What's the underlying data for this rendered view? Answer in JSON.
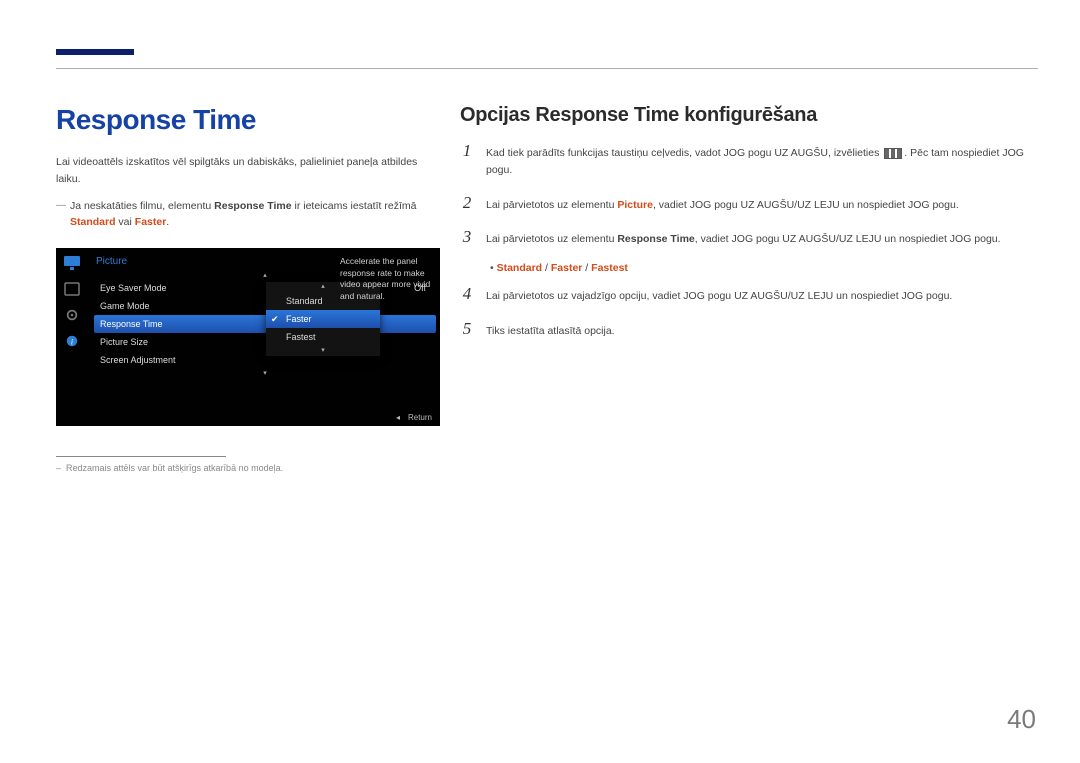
{
  "page_number": "40",
  "left": {
    "heading": "Response Time",
    "intro": "Lai videoattēls izskatītos vēl spilgtāks un dabiskāks, palieliniet paneļa atbildes laiku.",
    "note_pre": "Ja neskatāties filmu, elementu ",
    "note_bold1": "Response Time",
    "note_mid": " ir ieteicams iestatīt režīmā ",
    "note_bold2": "Standard",
    "note_or": " vai ",
    "note_bold3": "Faster",
    "note_end": ".",
    "footnote": "Redzamais attēls var būt atšķirīgs atkarībā no modeļa."
  },
  "osd": {
    "title": "Picture",
    "rows": [
      {
        "label": "Eye Saver Mode",
        "value": "Off"
      },
      {
        "label": "Game Mode",
        "value": ""
      },
      {
        "label": "Response Time",
        "value": ""
      },
      {
        "label": "Picture Size",
        "value": ""
      },
      {
        "label": "Screen Adjustment",
        "value": ""
      }
    ],
    "options": [
      "Standard",
      "Faster",
      "Fastest"
    ],
    "selected_option": 1,
    "desc": "Accelerate the panel response rate to make video appear more vivid and natural.",
    "return": "Return"
  },
  "right": {
    "heading": "Opcijas Response Time konfigurēšana",
    "steps": {
      "s1a": "Kad tiek parādīts funkcijas taustiņu ceļvedis, vadot JOG pogu UZ AUGŠU, izvēlieties ",
      "s1b": ". Pēc tam nospiediet JOG pogu.",
      "s2a": "Lai pārvietotos uz elementu ",
      "s2b": "Picture",
      "s2c": ", vadiet JOG pogu UZ AUGŠU/UZ LEJU un nospiediet JOG pogu.",
      "s3a": "Lai pārvietotos uz elementu ",
      "s3b": "Response Time",
      "s3c": ", vadiet JOG pogu UZ AUGŠU/UZ LEJU un nospiediet JOG pogu.",
      "opts_a": "Standard",
      "opts_b": "Faster",
      "opts_c": "Fastest",
      "sep": " / ",
      "s4": "Lai pārvietotos uz vajadzīgo opciju, vadiet JOG pogu UZ AUGŠU/UZ LEJU un nospiediet JOG pogu.",
      "s5": "Tiks iestatīta atlasītā opcija."
    }
  }
}
